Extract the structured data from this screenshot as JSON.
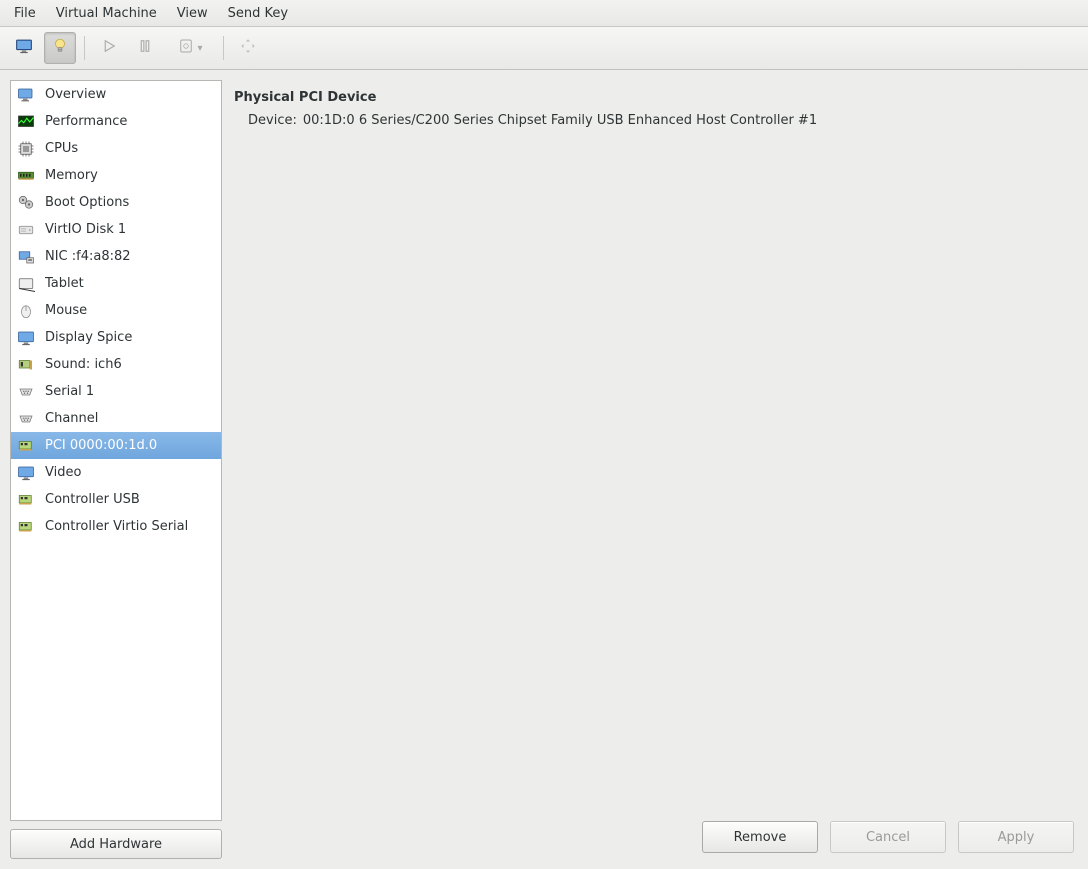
{
  "menubar": {
    "file": "File",
    "vm": "Virtual Machine",
    "view": "View",
    "sendkey": "Send Key"
  },
  "toolbar": {
    "console_icon": "monitor-icon",
    "details_icon": "lightbulb-icon",
    "run_icon": "play-icon",
    "pause_icon": "pause-icon",
    "shutdown_icon": "power-dropdown-icon",
    "fullscreen_icon": "fullscreen-icon"
  },
  "sidebar": {
    "add_label": "Add Hardware",
    "items": [
      {
        "label": "Overview",
        "icon": "computer-icon"
      },
      {
        "label": "Performance",
        "icon": "perf-icon"
      },
      {
        "label": "CPUs",
        "icon": "cpu-icon"
      },
      {
        "label": "Memory",
        "icon": "memory-icon"
      },
      {
        "label": "Boot Options",
        "icon": "boot-icon"
      },
      {
        "label": "VirtIO Disk 1",
        "icon": "disk-icon"
      },
      {
        "label": "NIC :f4:a8:82",
        "icon": "nic-icon"
      },
      {
        "label": "Tablet",
        "icon": "tablet-icon"
      },
      {
        "label": "Mouse",
        "icon": "mouse-icon"
      },
      {
        "label": "Display Spice",
        "icon": "display-icon"
      },
      {
        "label": "Sound: ich6",
        "icon": "sound-icon"
      },
      {
        "label": "Serial 1",
        "icon": "serial-icon"
      },
      {
        "label": "Channel",
        "icon": "serial-icon"
      },
      {
        "label": "PCI 0000:00:1d.0",
        "icon": "pcicard-icon",
        "selected": true
      },
      {
        "label": "Video",
        "icon": "display-icon"
      },
      {
        "label": "Controller USB",
        "icon": "pcicard-icon"
      },
      {
        "label": "Controller Virtio Serial",
        "icon": "pcicard-icon"
      }
    ]
  },
  "details": {
    "heading": "Physical PCI Device",
    "device_label": "Device:",
    "device_value": "00:1D:0 6 Series/C200 Series Chipset Family USB Enhanced Host Controller #1"
  },
  "actions": {
    "remove": "Remove",
    "cancel": "Cancel",
    "apply": "Apply"
  }
}
